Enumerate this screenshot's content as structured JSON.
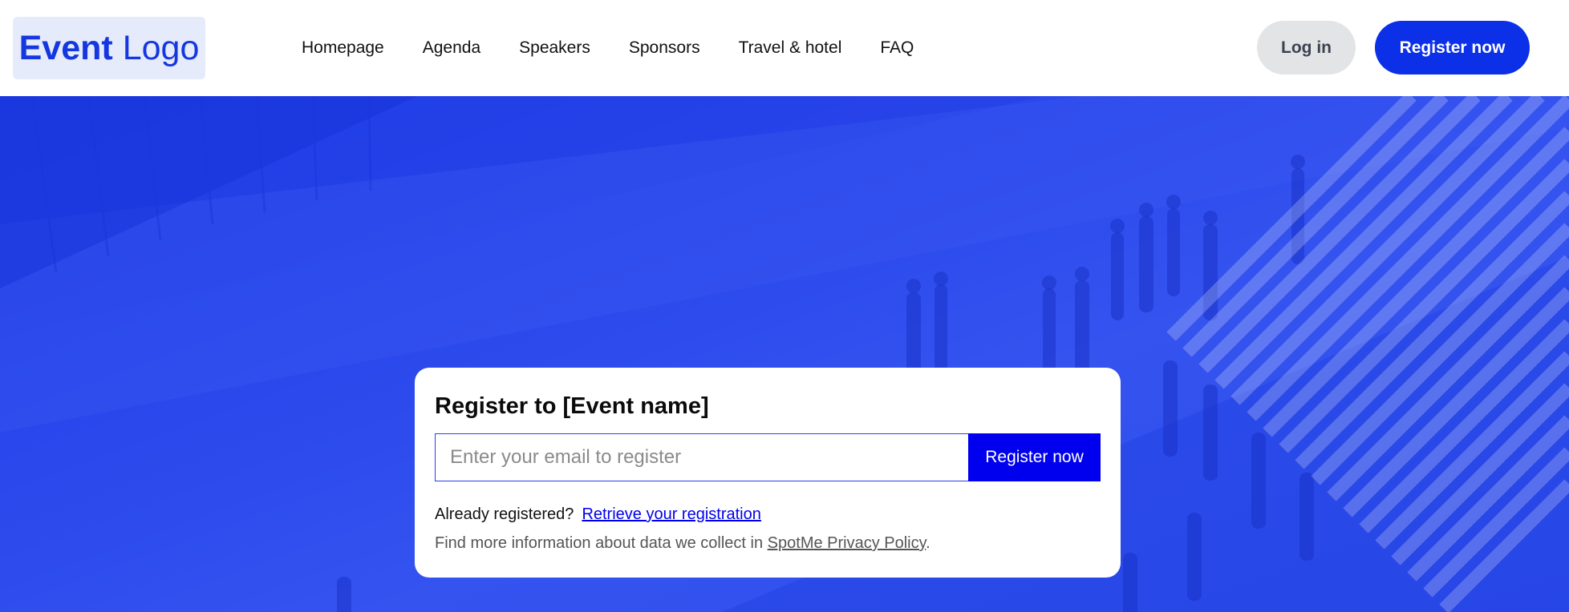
{
  "header": {
    "logo": {
      "bold": "Event",
      "light": "Logo"
    },
    "nav": [
      "Homepage",
      "Agenda",
      "Speakers",
      "Sponsors",
      "Travel & hotel",
      "FAQ"
    ],
    "login_label": "Log in",
    "register_label": "Register now"
  },
  "card": {
    "title": "Register to [Event name]",
    "email_placeholder": "Enter your email to register",
    "email_value": "",
    "register_label": "Register now",
    "already_text": "Already registered?",
    "retrieve_link": "Retrieve your registration",
    "privacy_prefix": "Find more information about data we collect in",
    "privacy_link": "SpotMe Privacy Policy",
    "privacy_suffix": "."
  },
  "colors": {
    "brand": "#0b30e8",
    "hero": "#2a48ec",
    "logo_bg": "#e6ebfb",
    "link": "#0000ee"
  }
}
